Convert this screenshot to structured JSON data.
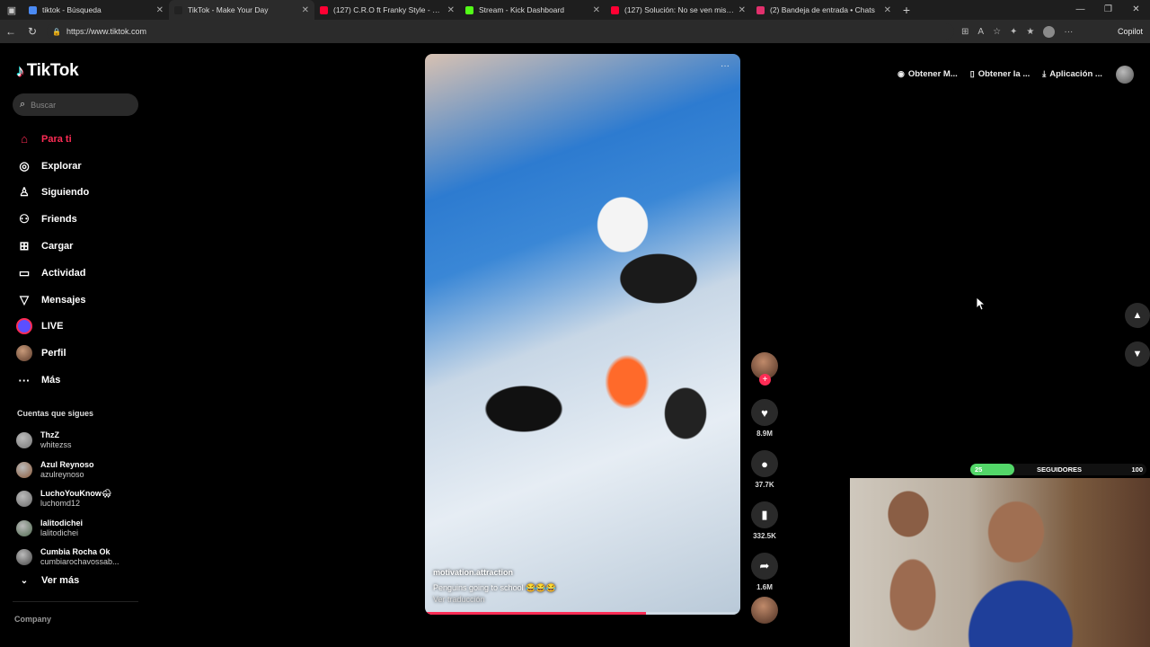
{
  "browser": {
    "tabs": [
      {
        "title": "tiktok - Búsqueda",
        "fav_color": "#4a8af4"
      },
      {
        "title": "TikTok - Make Your Day",
        "fav_color": "#222222"
      },
      {
        "title": "(127) C.R.O ft Franky Style - Si o No",
        "fav_color": "#ff0033"
      },
      {
        "title": "Stream - Kick Dashboard",
        "fav_color": "#53fc18"
      },
      {
        "title": "(127) Solución: No se ven mis alertas",
        "fav_color": "#ff0033"
      },
      {
        "title": "(2) Bandeja de entrada • Chats",
        "fav_color": "#e1306c"
      }
    ],
    "url": "https://www.tiktok.com",
    "copilot_label": "Copilot"
  },
  "sidebar": {
    "logo": "TikTok",
    "search_placeholder": "Buscar",
    "menu": [
      {
        "label": "Para ti",
        "icon": "home-icon"
      },
      {
        "label": "Explorar",
        "icon": "compass-icon"
      },
      {
        "label": "Siguiendo",
        "icon": "following-icon"
      },
      {
        "label": "Friends",
        "icon": "friends-icon"
      },
      {
        "label": "Cargar",
        "icon": "upload-icon"
      },
      {
        "label": "Actividad",
        "icon": "activity-icon"
      },
      {
        "label": "Mensajes",
        "icon": "messages-icon"
      },
      {
        "label": "LIVE",
        "icon": "live-icon"
      },
      {
        "label": "Perfil",
        "icon": "profile-avatar"
      },
      {
        "label": "Más",
        "icon": "more-icon"
      }
    ],
    "following_header": "Cuentas que sigues",
    "following": [
      {
        "name": "ThzZ",
        "handle": "whitezss",
        "color": "#777777"
      },
      {
        "name": "Azul Reynoso",
        "handle": "azulreynoso",
        "color": "#8a5a3a"
      },
      {
        "name": "LuchoYouKnow🌨",
        "handle": "luchomd12",
        "color": "#6a6a6a"
      },
      {
        "name": "lalitodichei",
        "handle": "lalitodichei",
        "color": "#4f6a4f"
      },
      {
        "name": "Cumbia Rocha Ok",
        "handle": "cumbiarochavossab...",
        "color": "#444444"
      }
    ],
    "see_more": "Ver más",
    "company": "Company"
  },
  "top_actions": [
    {
      "label": "Obtener M...",
      "icon": "coin-icon"
    },
    {
      "label": "Obtener la ...",
      "icon": "phone-icon"
    },
    {
      "label": "Aplicación ...",
      "icon": "download-icon"
    }
  ],
  "video": {
    "username": "motivation.attraction",
    "caption": "Penguins going to school 😂😂😂",
    "translate": "Ver traducción",
    "progress": 0.7
  },
  "actions": {
    "likes": "8.9M",
    "comments": "37.7K",
    "saves": "332.5K",
    "shares": "1.6M"
  },
  "stream_overlay": {
    "followers_current": "25",
    "followers_label": "SEGUIDORES",
    "followers_goal": "100",
    "followers_progress": 0.25,
    "accent": "#53d769"
  }
}
